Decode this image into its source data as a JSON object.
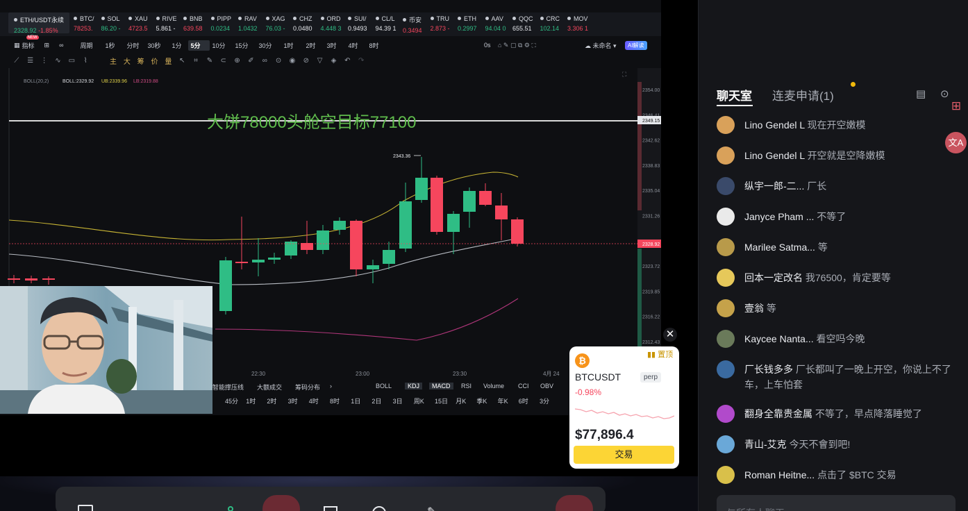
{
  "chart": {
    "pair": "ETH/USDT永续",
    "price": "2328.92",
    "change": "-1.85%",
    "tickers": [
      {
        "sym": "BTC/",
        "px": "78253.",
        "dir": "dn"
      },
      {
        "sym": "SOL",
        "px": "86.20 -",
        "dir": "up"
      },
      {
        "sym": "XAU",
        "px": "4723.5",
        "dir": "dn"
      },
      {
        "sym": "RIVE",
        "px": "5.861 -",
        "dir": "wh"
      },
      {
        "sym": "BNB",
        "px": "639.58",
        "dir": "dn"
      },
      {
        "sym": "PIPP",
        "px": "0.0234",
        "dir": "up"
      },
      {
        "sym": "RAV",
        "px": "1.0432",
        "dir": "up"
      },
      {
        "sym": "XAG",
        "px": "76.03 -",
        "dir": "up"
      },
      {
        "sym": "CHZ",
        "px": "0.0480",
        "dir": "wh"
      },
      {
        "sym": "ORD",
        "px": "4.448 3",
        "dir": "up"
      },
      {
        "sym": "SUI/",
        "px": "0.9493",
        "dir": "wh"
      },
      {
        "sym": "CL/L",
        "px": "94.39 1",
        "dir": "wh"
      },
      {
        "sym": "币安",
        "px": "0.3494",
        "dir": "dn"
      },
      {
        "sym": "TRU",
        "px": "2.873 -",
        "dir": "dn"
      },
      {
        "sym": "ETH",
        "px": "0.2997",
        "dir": "up"
      },
      {
        "sym": "AAV",
        "px": "94.04 0",
        "dir": "up"
      },
      {
        "sym": "QQC",
        "px": "655.51",
        "dir": "wh"
      },
      {
        "sym": "CRC",
        "px": "102.14",
        "dir": "up"
      },
      {
        "sym": "MOV",
        "px": "3.306 1",
        "dir": "dn"
      }
    ],
    "toolbar1": {
      "indicator": "指标",
      "new_badge": "NEW",
      "period": "周期",
      "timeframes": [
        "1秒",
        "分时",
        "30秒",
        "1分",
        "5分",
        "10分",
        "15分",
        "30分",
        "1时",
        "2时",
        "3时",
        "4时",
        "8时"
      ],
      "active_tf": "5分",
      "countdown": "0s",
      "unnamed": "未命名",
      "ai": "AI解读"
    },
    "boll_label": "BOLL(20,2)",
    "boll_mid": "BOLL:2329.92",
    "boll_ub": "UB:2339.96",
    "boll_lb": "LB:2319.88",
    "annotation": "大饼78000头舱空目标77100",
    "high_marker": "2343.36",
    "y_ticks": [
      "2354.00",
      "2346.41",
      "2342.62",
      "2338.83",
      "2335.04",
      "2331.26",
      "2327.47",
      "2323.72",
      "2319.85",
      "2316.22",
      "2312.43"
    ],
    "line_price": "2349.15",
    "current_price_tag": "2328.92",
    "x_ticks": [
      "22:30",
      "23:00",
      "23:30",
      "4月 24"
    ],
    "indicators": [
      "智能撑压线",
      "大额成交",
      "筹码分布",
      "BOLL",
      "KDJ",
      "MACD",
      "RSI",
      "Volume",
      "CCI",
      "OBV"
    ],
    "timeframes_bottom": [
      "45分",
      "1时",
      "2时",
      "3时",
      "4时",
      "8时",
      "1日",
      "2日",
      "3日",
      "周K",
      "15日",
      "月K",
      "季K",
      "年K",
      "6时",
      "3分"
    ]
  },
  "chat": {
    "tab_active": "聊天室",
    "tab_other": "连麦申请(1)",
    "messages": [
      {
        "name": "Lino Gendel L",
        "text": "现在开空嫩模"
      },
      {
        "name": "Lino Gendel L",
        "text": "开空就是空降嫩模"
      },
      {
        "name": "纵宇一郎-二...",
        "text": "厂长"
      },
      {
        "name": "Janyce Pham ...",
        "text": "不等了"
      },
      {
        "name": "Marilee Satma...",
        "text": "等"
      },
      {
        "name": "回本一定改名",
        "text": "我76500，肯定要等"
      },
      {
        "name": "壹翁",
        "text": "等"
      },
      {
        "name": "Kaycee Nanta...",
        "text": "看空吗今晚"
      },
      {
        "name": "厂长钱多多",
        "text": "厂长都叫了一晚上开空，你说上不了车，上车怕套"
      },
      {
        "name": "翻身全靠贵金属",
        "text": "不等了，早点降落睡觉了"
      },
      {
        "name": "青山-艾克",
        "text": "今天不會到吧!"
      },
      {
        "name": "Roman Heitne...",
        "text": "点击了 $BTC 交易"
      }
    ],
    "input_placeholder": "与所有人聊天"
  },
  "btc_card": {
    "pin": "置顶",
    "symbol": "BTCUSDT",
    "tag": "perp",
    "change": "-0.98%",
    "price": "$77,896.4",
    "trade": "交易"
  },
  "colors": {
    "up": "#2fbd85",
    "down": "#f6465d",
    "accent": "#f0b90b"
  }
}
